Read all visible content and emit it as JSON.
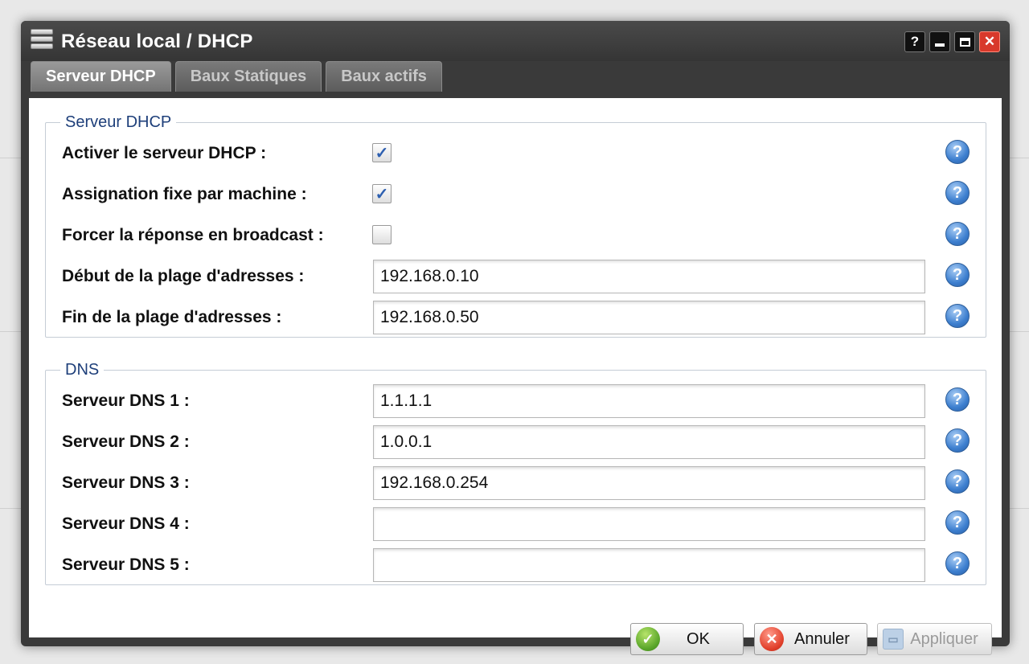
{
  "window": {
    "title": "Réseau local / DHCP",
    "controls": {
      "help": "?",
      "minimize": "",
      "maximize": "",
      "close": "✕"
    }
  },
  "tabs": [
    {
      "label": "Serveur DHCP",
      "active": true
    },
    {
      "label": "Baux Statiques",
      "active": false
    },
    {
      "label": "Baux actifs",
      "active": false
    }
  ],
  "dhcp": {
    "legend": "Serveur DHCP",
    "enable": {
      "label": "Activer le serveur DHCP :",
      "checked": true
    },
    "fixed": {
      "label": "Assignation fixe par machine :",
      "checked": true
    },
    "broadcast": {
      "label": "Forcer la réponse en broadcast :",
      "checked": false
    },
    "range_start": {
      "label": "Début de la plage d'adresses :",
      "value": "192.168.0.10"
    },
    "range_end": {
      "label": "Fin de la plage d'adresses :",
      "value": "192.168.0.50"
    }
  },
  "dns": {
    "legend": "DNS",
    "servers": [
      {
        "label": "Serveur DNS 1 :",
        "value": "1.1.1.1"
      },
      {
        "label": "Serveur DNS 2 :",
        "value": "1.0.0.1"
      },
      {
        "label": "Serveur DNS 3 :",
        "value": "192.168.0.254"
      },
      {
        "label": "Serveur DNS 4 :",
        "value": ""
      },
      {
        "label": "Serveur DNS 5 :",
        "value": ""
      }
    ]
  },
  "help_icon": "?",
  "check_mark": "✓",
  "buttons": {
    "ok": "OK",
    "ok_icon": "✓",
    "cancel": "Annuler",
    "cancel_icon": "✕",
    "apply": "Appliquer",
    "apply_icon": "▭",
    "apply_enabled": false
  }
}
